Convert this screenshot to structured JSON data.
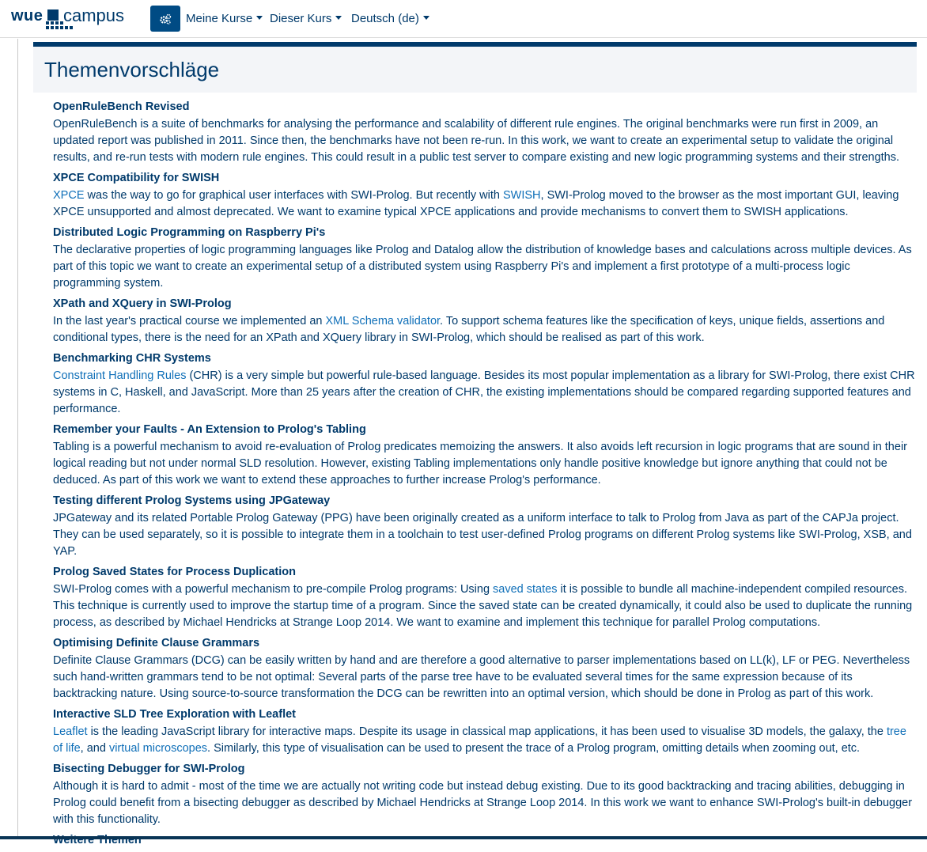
{
  "brand": {
    "prefix": "wue",
    "suffix": "campus"
  },
  "nav": {
    "menu": [
      {
        "label": "Meine Kurse"
      },
      {
        "label": "Dieser Kurs"
      },
      {
        "label": "Deutsch (de)"
      }
    ]
  },
  "section": {
    "title": "Themenvorschläge"
  },
  "topics": [
    {
      "title": "OpenRuleBench Revised",
      "text": "OpenRuleBench is a suite of benchmarks for analysing the performance and scalability of different rule engines. The original benchmarks were run first in 2009, an updated report was published in 2011. Since then, the benchmarks have not been re-run. In this work, we want to create an experimental setup to validate the original results, and re-run tests with modern rule engines. This could result in a public test server to compare existing and new logic programming systems and their strengths."
    },
    {
      "title": "XPCE Compatibility for SWISH",
      "link1": "XPCE",
      "text1": " was the way to go for graphical user interfaces with SWI-Prolog. But recently with ",
      "link2": "SWISH",
      "text2": ", SWI-Prolog moved to the browser as the most important GUI, leaving XPCE unsupported and almost deprecated. We want to examine typical XPCE applications and provide mechanisms to convert them to SWISH applications."
    },
    {
      "title": "Distributed Logic Programming on Raspberry Pi's",
      "text": "The declarative properties of logic programming languages like Prolog and Datalog allow the distribution of knowledge bases and calculations across multiple devices. As part of this topic we want to create an experimental setup of a distributed system using Raspberry Pi's and implement a first prototype of a multi-process logic programming system."
    },
    {
      "title": "XPath and XQuery in SWI-Prolog",
      "text1": "In the last year's practical course we implemented an ",
      "link1": "XML Schema validator",
      "text2": ". To support schema features like the specification of keys, unique fields, assertions and conditional types, there is the need for an XPath and XQuery library in SWI-Prolog, which should be realised as part of this work."
    },
    {
      "title": "Benchmarking CHR Systems",
      "link1": "Constraint Handling Rules",
      "text1": " (CHR) is a very simple but powerful rule-based language. Besides its most popular implementation as a library for SWI-Prolog, there exist CHR systems in C, Haskell, and JavaScript. More than 25 years after the creation of CHR, the existing implementations should be compared regarding supported features and performance."
    },
    {
      "title": "Remember your Faults - An Extension to Prolog's Tabling",
      "text": "Tabling is a powerful mechanism to avoid re-evaluation of Prolog predicates memoizing the answers. It also avoids left recursion in logic programs that are sound in their logical reading but not under normal SLD resolution. However, existing Tabling implementations only handle positive knowledge but ignore anything that could not be deduced. As part of this work we want to extend these approaches to further increase Prolog's performance."
    },
    {
      "title": "Testing different Prolog Systems using JPGateway",
      "text": "JPGateway and its related Portable Prolog Gateway (PPG) have been originally created as a uniform interface to talk to Prolog from Java as part of the CAPJa project. They can be used separately, so it is possible to integrate them in a toolchain to test user-defined Prolog programs on different Prolog systems like SWI-Prolog, XSB, and YAP."
    },
    {
      "title": "Prolog Saved States for Process Duplication",
      "text1": "SWI-Prolog comes with a powerful mechanism to pre-compile Prolog programs: Using ",
      "link1": "saved states",
      "text2": " it is possible to bundle all machine-independent compiled resources. This technique is currently used to improve the startup time of a program. Since the saved state can be created dynamically, it could also be used to duplicate the running process, as described by Michael Hendricks at Strange Loop 2014. We want to examine and implement this technique for parallel Prolog computations."
    },
    {
      "title": "Optimising Definite Clause Grammars",
      "text": "Definite Clause Grammars (DCG) can be easily written by hand and are therefore a good alternative to parser implementations based on LL(k), LF or PEG. Nevertheless such hand-written grammars tend to be not optimal: Several parts of the parse tree have to be evaluated several times for the same expression because of its backtracking nature. Using source-to-source transformation the DCG can be rewritten into an optimal version, which should be done in Prolog as part of this work."
    },
    {
      "title": "Interactive SLD Tree Exploration with Leaflet",
      "link1": "Leaflet",
      "text1": " is the leading JavaScript library for interactive maps. Despite its usage in classical map applications, it has been used to visualise 3D models, the galaxy, the ",
      "link2": "tree of life",
      "text2": ", and ",
      "link3": "virtual microscopes",
      "text3": ". Similarly, this type of visualisation can be used to present the trace of a Prolog program, omitting details when zooming out, etc."
    },
    {
      "title": "Bisecting Debugger for SWI-Prolog",
      "text": "Although it is hard to admit - most of the time we are actually not writing code but instead debug existing. Due to its good backtracking and tracing abilities, debugging in Prolog could benefit from a bisecting debugger as described by Michael Hendricks at Strange Loop 2014. In this work we want to enhance SWI-Prolog's built-in debugger with this functionality."
    },
    {
      "title": "Weitere Themen"
    }
  ],
  "colors": {
    "primary": "#003a6b",
    "link": "#0f6fb8",
    "toggle": "#004b84",
    "header_bg": "#f3f5f8"
  },
  "icons": {
    "nav_toggle": "cogs-icon",
    "dropdown": "caret-down-icon"
  }
}
